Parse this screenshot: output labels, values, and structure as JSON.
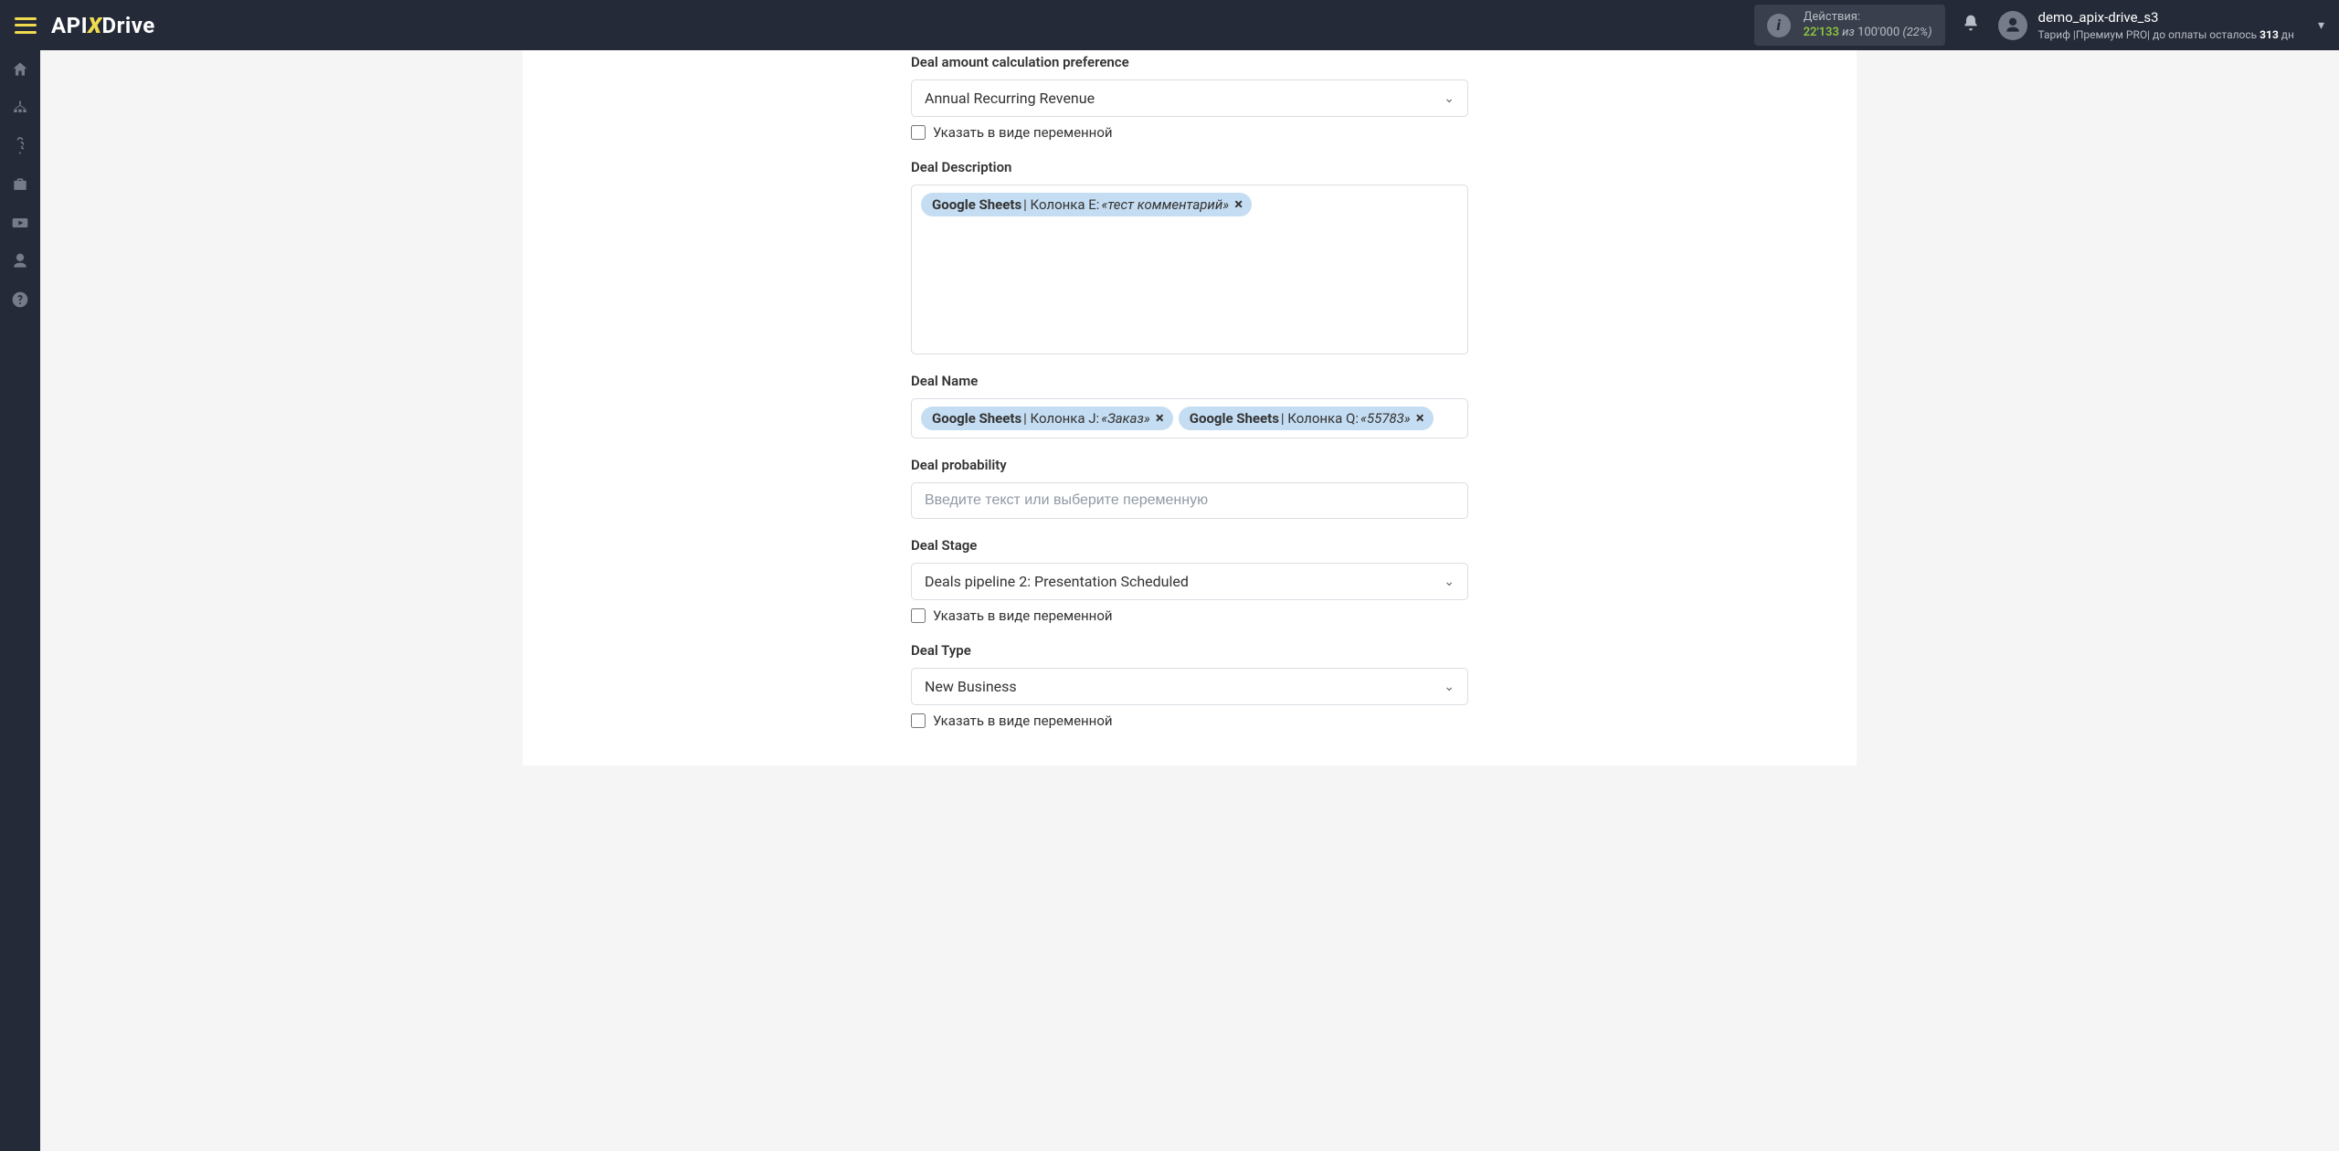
{
  "header": {
    "logo_api": "API",
    "logo_x": "X",
    "logo_drive": "Drive",
    "actions_label": "Действия:",
    "actions_used": "22'133",
    "actions_of": "из",
    "actions_total": "100'000",
    "actions_pct": "(22%)",
    "user_name": "demo_apix-drive_s3",
    "tariff_prefix": "Тариф |",
    "tariff_plan": "Премиум PRO",
    "tariff_mid": "| до оплаты осталось ",
    "tariff_days": "313",
    "tariff_suffix": " дн"
  },
  "fields": {
    "amount_pref": {
      "label": "Deal amount calculation preference",
      "value": "Annual Recurring Revenue",
      "checkbox": "Указать в виде переменной"
    },
    "description": {
      "label": "Deal Description",
      "tag1_src": "Google Sheets",
      "tag1_col": " | Колонка E: ",
      "tag1_val": "«тест комментарий»"
    },
    "name": {
      "label": "Deal Name",
      "tag1_src": "Google Sheets",
      "tag1_col": " | Колонка J: ",
      "tag1_val": "«Заказ»",
      "tag2_src": "Google Sheets",
      "tag2_col": " | Колонка Q: ",
      "tag2_val": "«55783»"
    },
    "probability": {
      "label": "Deal probability",
      "placeholder": "Введите текст или выберите переменную"
    },
    "stage": {
      "label": "Deal Stage",
      "value": "Deals pipeline 2: Presentation Scheduled",
      "checkbox": "Указать в виде переменной"
    },
    "type": {
      "label": "Deal Type",
      "value": "New Business",
      "checkbox": "Указать в виде переменной"
    }
  }
}
